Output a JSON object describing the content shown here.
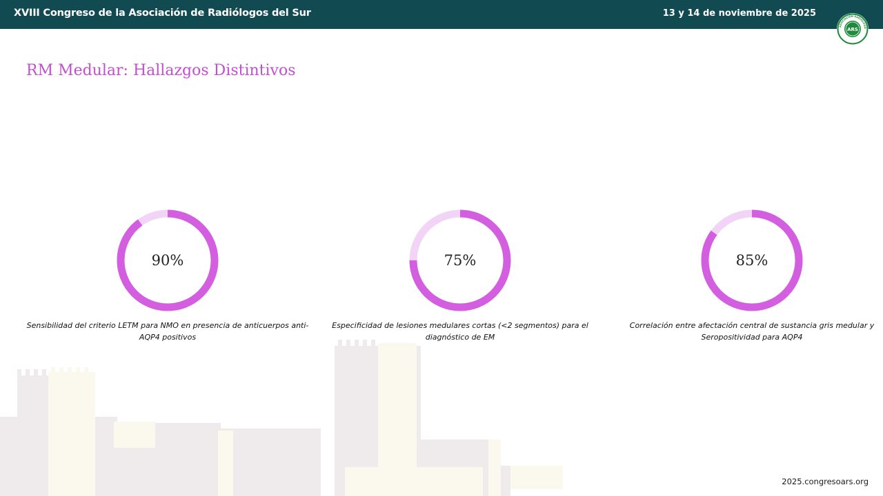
{
  "header": {
    "conference": "XVIII Congreso de la Asociación de Radiólogos del Sur",
    "date": "13 y 14 de noviembre de 2025",
    "logo_text": "ARS",
    "logo_ring_text": "ASOCIACIÓN RADIÓLOGOS SUR"
  },
  "slide": {
    "title": "RM Medular: Hallazgos Distintivos"
  },
  "stats": [
    {
      "value": "90%",
      "percent": 90,
      "caption": "Sensibilidad del criterio LETM para NMO en presencia de anticuerpos anti-AQP4 positivos"
    },
    {
      "value": "75%",
      "percent": 75,
      "caption": "Especificidad de lesiones medulares cortas (<2 segmentos) para el diagnóstico de EM"
    },
    {
      "value": "85%",
      "percent": 85,
      "caption": "Correlación entre afectación central de sustancia gris medular y Seropositividad para AQP4"
    }
  ],
  "footer": {
    "website": "2025.congresoars.org"
  },
  "colors": {
    "header_bg": "#124a52",
    "accent": "#d35ee0",
    "ring_track": "#f2d4f6",
    "logo_green": "#1e8a3c"
  }
}
